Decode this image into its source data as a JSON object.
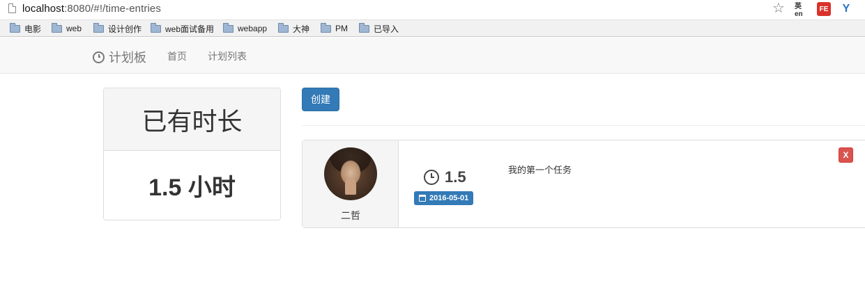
{
  "browser": {
    "url_host": "localhost",
    "url_rest": ":8080/#!/time-entries",
    "extensions": [
      {
        "icon": "translate-extension-icon",
        "label": "英en"
      },
      {
        "icon": "fe-extension-icon",
        "label": "FE"
      },
      {
        "icon": "v-extension-icon",
        "label": "Y"
      }
    ]
  },
  "bookmarks": [
    {
      "icon": "folder-icon",
      "label": "电影"
    },
    {
      "icon": "folder-icon",
      "label": "web"
    },
    {
      "icon": "folder-icon",
      "label": "设计创作"
    },
    {
      "icon": "folder-icon",
      "label": "web面试备用"
    },
    {
      "icon": "folder-icon",
      "label": "webapp"
    },
    {
      "icon": "folder-icon",
      "label": "大神"
    },
    {
      "icon": "folder-icon",
      "label": "PM"
    },
    {
      "icon": "folder-icon",
      "label": "已导入"
    }
  ],
  "navbar": {
    "brand": "计划板",
    "brand_icon": "clock-icon",
    "links": [
      "首页",
      "计划列表"
    ]
  },
  "summary": {
    "heading": "已有时长",
    "value": "1.5 小时"
  },
  "main": {
    "create_label": "创建",
    "entries": [
      {
        "user_name": "二哲",
        "hours": "1.5",
        "date": "2016-05-01",
        "comment": "我的第一个任务",
        "delete_label": "X"
      }
    ]
  },
  "colors": {
    "primary": "#337ab7",
    "danger": "#d9534f",
    "navbar_bg": "#f8f8f8",
    "panel_heading_bg": "#f5f5f5"
  }
}
